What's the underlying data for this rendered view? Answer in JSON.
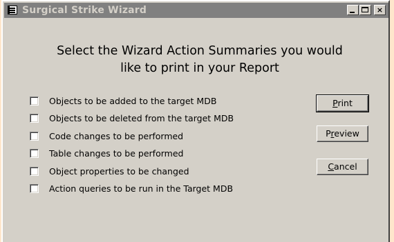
{
  "window": {
    "title": "Surgical Strike Wizard",
    "icon": "form-icon"
  },
  "titlebar_buttons": {
    "minimize": "minimize",
    "maximize": "maximize",
    "close": "×"
  },
  "heading": {
    "line1": "Select the Wizard Action Summaries you would",
    "line2": "like to print in your Report"
  },
  "options": [
    {
      "label": "Objects to be added to the target MDB",
      "checked": false
    },
    {
      "label": "Objects to be deleted from the target MDB",
      "checked": false
    },
    {
      "label": "Code changes to be performed",
      "checked": false
    },
    {
      "label": "Table changes to be performed",
      "checked": false
    },
    {
      "label": "Object properties to be changed",
      "checked": false
    },
    {
      "label": "Action queries to be run in the Target MDB",
      "checked": false
    }
  ],
  "buttons": {
    "print": {
      "mnemonic": "P",
      "rest": "rint"
    },
    "preview": {
      "pre": "P",
      "mnemonic": "r",
      "rest": "eview"
    },
    "cancel": {
      "mnemonic": "C",
      "rest": "ancel"
    }
  },
  "colors": {
    "titlebar_inactive": "#808080",
    "face": "#d4d0c8",
    "background": "#ffe6cc"
  }
}
